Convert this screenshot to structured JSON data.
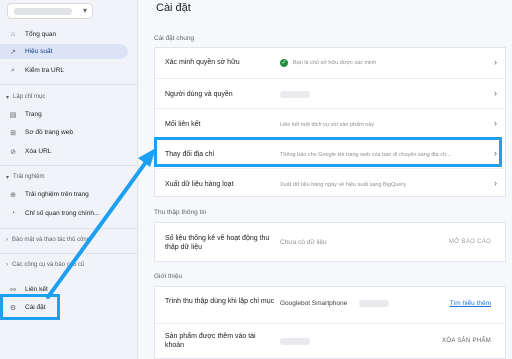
{
  "sidebar": {
    "items": [
      {
        "label": "Tổng quan",
        "icon": "home-icon"
      },
      {
        "label": "Hiệu suất",
        "icon": "trending-icon"
      },
      {
        "label": "Kiểm tra URL",
        "icon": "search-icon"
      }
    ],
    "section_index": "Lập chỉ mục",
    "index_items": [
      {
        "label": "Trang",
        "icon": "page-icon"
      },
      {
        "label": "Sơ đồ trang web",
        "icon": "sitemap-icon"
      },
      {
        "label": "Xóa URL",
        "icon": "remove-icon"
      }
    ],
    "section_experience": "Trải nghiệm",
    "experience_items": [
      {
        "label": "Trải nghiệm trên trang",
        "icon": "experience-icon"
      },
      {
        "label": "Chỉ số quan trọng chính...",
        "icon": "gauge-icon"
      }
    ],
    "section_security": "Bảo mật và thao tác thủ công",
    "section_legacy": "Các công cụ và báo cáo cũ",
    "links_label": "Liên kết",
    "settings_label": "Cài đặt"
  },
  "main": {
    "title": "Cài đặt",
    "general_section": "Cài đặt chung",
    "general_rows": [
      {
        "label": "Xác minh quyền sở hữu",
        "desc": "Bạn là chủ sở hữu được xác minh"
      },
      {
        "label": "Người dùng và quyền",
        "desc": ""
      },
      {
        "label": "Mối liên kết",
        "desc": "Liên kết một dịch vụ với sản phẩm này"
      },
      {
        "label": "Thay đổi địa chỉ",
        "desc": "Thông báo cho Google khi trang web của bạn di chuyển sang địa ch..."
      },
      {
        "label": "Xuất dữ liệu hàng loạt",
        "desc": "Xuất dữ liệu hàng ngày về hiệu suất sang BigQuery"
      }
    ],
    "crawl_section": "Thu thập thông tin",
    "crawl_row": {
      "label": "Số liệu thống kê về hoạt động thu thập dữ liệu",
      "desc": "Chưa có dữ liệu",
      "action": "MỞ BÁO CÁO"
    },
    "about_section": "Giới thiệu",
    "about_rows": [
      {
        "label": "Trình thu thập dùng khi lập chỉ mục",
        "desc": "Googlebot Smartphone",
        "action": "Tìm hiểu thêm"
      },
      {
        "label": "Sản phẩm được thêm vào tài khoản",
        "desc": "",
        "action": "XÓA SẢN PHẨM"
      }
    ]
  },
  "colors": {
    "highlight": "#1ea0f2",
    "active_nav": "#dbe4f7",
    "link": "#1a73e8",
    "check": "#1e8e3e"
  }
}
